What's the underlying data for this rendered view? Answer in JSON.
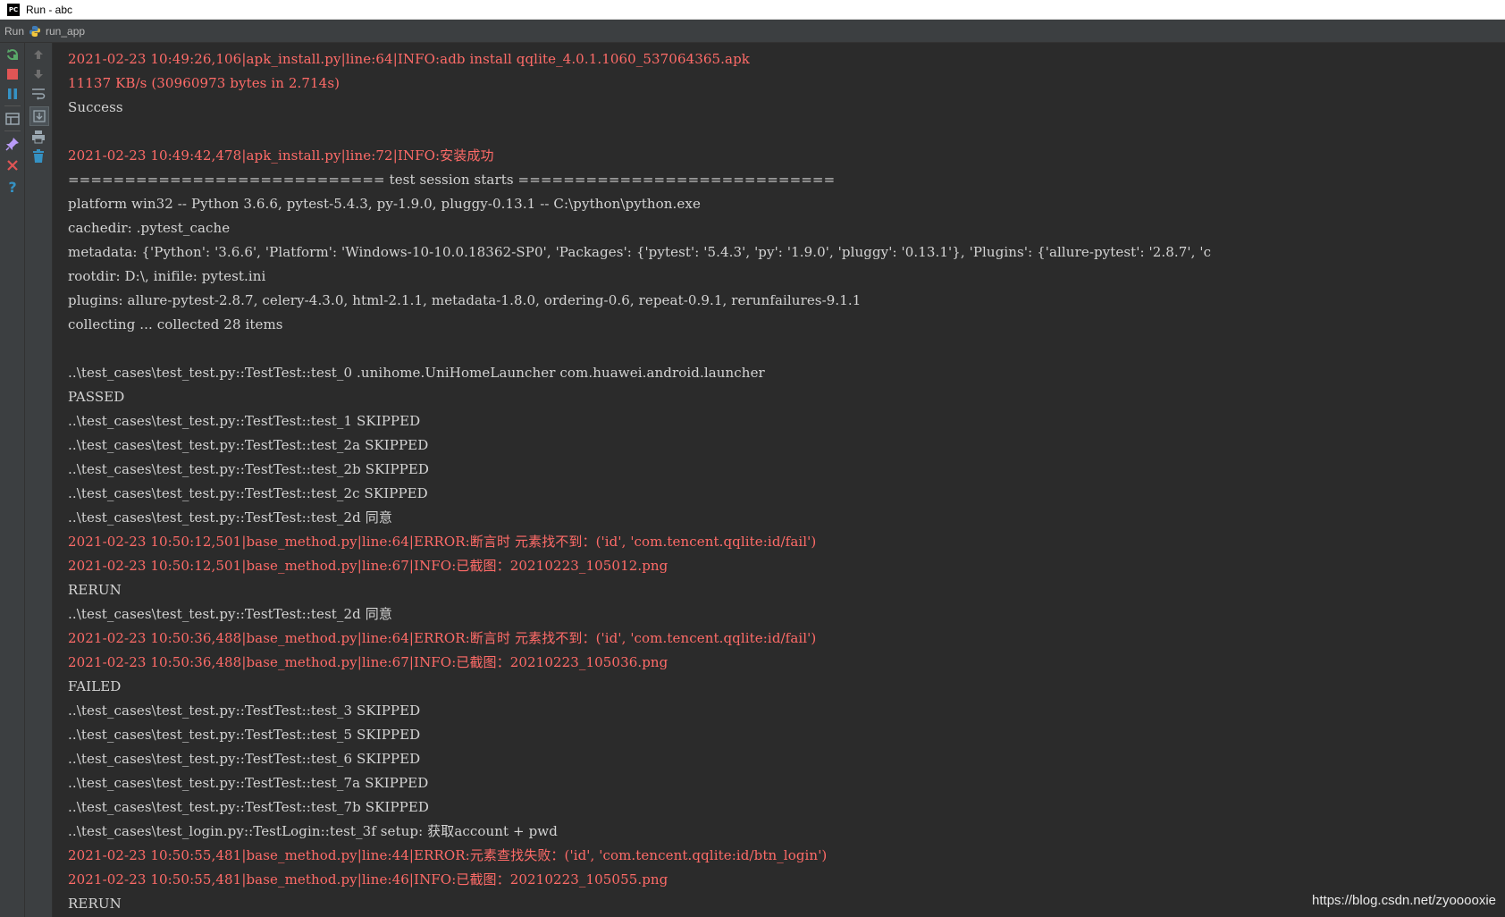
{
  "window": {
    "title": "Run - abc",
    "logo_text": "PC"
  },
  "run_bar": {
    "label": "Run",
    "config_name": "run_app",
    "config_icon": "python-icon"
  },
  "toolbar": {
    "left": [
      {
        "name": "rerun-icon",
        "color": "#59a869"
      },
      {
        "name": "stop-icon",
        "color": "#e05555"
      },
      {
        "name": "pause-icon",
        "color": "#3592c4"
      },
      {
        "name": "layout-icon",
        "color": "#9aa7b0"
      },
      {
        "name": "pin-icon",
        "color": "#b99bf8"
      },
      {
        "name": "close-icon",
        "color": "#e05555"
      },
      {
        "name": "help-icon",
        "color": "#3592c4"
      }
    ],
    "right": [
      {
        "name": "up-arrow-icon",
        "color": "#6e6e6e"
      },
      {
        "name": "down-arrow-icon",
        "color": "#6e6e6e"
      },
      {
        "name": "soft-wrap-icon",
        "color": "#9aa7b0"
      },
      {
        "name": "scroll-to-end-icon",
        "color": "#9aa7b0"
      },
      {
        "name": "print-icon",
        "color": "#9aa7b0"
      },
      {
        "name": "trash-icon",
        "color": "#9aa7b0"
      }
    ]
  },
  "colors": {
    "error_text": "#ff6b68",
    "normal_text": "#d4d4d4",
    "background": "#2b2b2b"
  },
  "console": {
    "lines": [
      {
        "text": "2021-02-23 10:49:26,106|apk_install.py|line:64|INFO:adb install qqlite_4.0.1.1060_537064365.apk",
        "style": "red"
      },
      {
        "text": "11137 KB/s (30960973 bytes in 2.714s)",
        "style": "red"
      },
      {
        "text": "Success",
        "style": "normal"
      },
      {
        "text": "",
        "style": "normal"
      },
      {
        "text": "2021-02-23 10:49:42,478|apk_install.py|line:72|INFO:安装成功",
        "style": "red"
      },
      {
        "text": "============================ test session starts ============================",
        "style": "normal"
      },
      {
        "text": "platform win32 -- Python 3.6.6, pytest-5.4.3, py-1.9.0, pluggy-0.13.1 -- C:\\python\\python.exe",
        "style": "normal"
      },
      {
        "text": "cachedir: .pytest_cache",
        "style": "normal"
      },
      {
        "text": "metadata: {'Python': '3.6.6', 'Platform': 'Windows-10-10.0.18362-SP0', 'Packages': {'pytest': '5.4.3', 'py': '1.9.0', 'pluggy': '0.13.1'}, 'Plugins': {'allure-pytest': '2.8.7', 'c",
        "style": "normal"
      },
      {
        "text": "rootdir: D:\\, inifile: pytest.ini",
        "style": "normal"
      },
      {
        "text": "plugins: allure-pytest-2.8.7, celery-4.3.0, html-2.1.1, metadata-1.8.0, ordering-0.6, repeat-0.9.1, rerunfailures-9.1.1",
        "style": "normal"
      },
      {
        "text": "collecting ... collected 28 items",
        "style": "normal"
      },
      {
        "text": "",
        "style": "normal"
      },
      {
        "text": "..\\test_cases\\test_test.py::TestTest::test_0 .unihome.UniHomeLauncher com.huawei.android.launcher",
        "style": "normal"
      },
      {
        "text": "PASSED",
        "style": "normal"
      },
      {
        "text": "..\\test_cases\\test_test.py::TestTest::test_1 SKIPPED",
        "style": "normal"
      },
      {
        "text": "..\\test_cases\\test_test.py::TestTest::test_2a SKIPPED",
        "style": "normal"
      },
      {
        "text": "..\\test_cases\\test_test.py::TestTest::test_2b SKIPPED",
        "style": "normal"
      },
      {
        "text": "..\\test_cases\\test_test.py::TestTest::test_2c SKIPPED",
        "style": "normal"
      },
      {
        "text": "..\\test_cases\\test_test.py::TestTest::test_2d 同意",
        "style": "normal"
      },
      {
        "text": "2021-02-23 10:50:12,501|base_method.py|line:64|ERROR:断言时 元素找不到：('id', 'com.tencent.qqlite:id/fail')",
        "style": "red"
      },
      {
        "text": "2021-02-23 10:50:12,501|base_method.py|line:67|INFO:已截图：20210223_105012.png",
        "style": "red"
      },
      {
        "text": "RERUN",
        "style": "normal"
      },
      {
        "text": "..\\test_cases\\test_test.py::TestTest::test_2d 同意",
        "style": "normal"
      },
      {
        "text": "2021-02-23 10:50:36,488|base_method.py|line:64|ERROR:断言时 元素找不到：('id', 'com.tencent.qqlite:id/fail')",
        "style": "red"
      },
      {
        "text": "2021-02-23 10:50:36,488|base_method.py|line:67|INFO:已截图：20210223_105036.png",
        "style": "red"
      },
      {
        "text": "FAILED",
        "style": "normal"
      },
      {
        "text": "..\\test_cases\\test_test.py::TestTest::test_3 SKIPPED",
        "style": "normal"
      },
      {
        "text": "..\\test_cases\\test_test.py::TestTest::test_5 SKIPPED",
        "style": "normal"
      },
      {
        "text": "..\\test_cases\\test_test.py::TestTest::test_6 SKIPPED",
        "style": "normal"
      },
      {
        "text": "..\\test_cases\\test_test.py::TestTest::test_7a SKIPPED",
        "style": "normal"
      },
      {
        "text": "..\\test_cases\\test_test.py::TestTest::test_7b SKIPPED",
        "style": "normal"
      },
      {
        "text": "..\\test_cases\\test_login.py::TestLogin::test_3f setup: 获取account + pwd",
        "style": "normal"
      },
      {
        "text": "2021-02-23 10:50:55,481|base_method.py|line:44|ERROR:元素查找失败：('id', 'com.tencent.qqlite:id/btn_login')",
        "style": "red"
      },
      {
        "text": "2021-02-23 10:50:55,481|base_method.py|line:46|INFO:已截图：20210223_105055.png",
        "style": "red"
      },
      {
        "text": "RERUN",
        "style": "normal"
      }
    ]
  },
  "watermark": "https://blog.csdn.net/zyooooxie"
}
